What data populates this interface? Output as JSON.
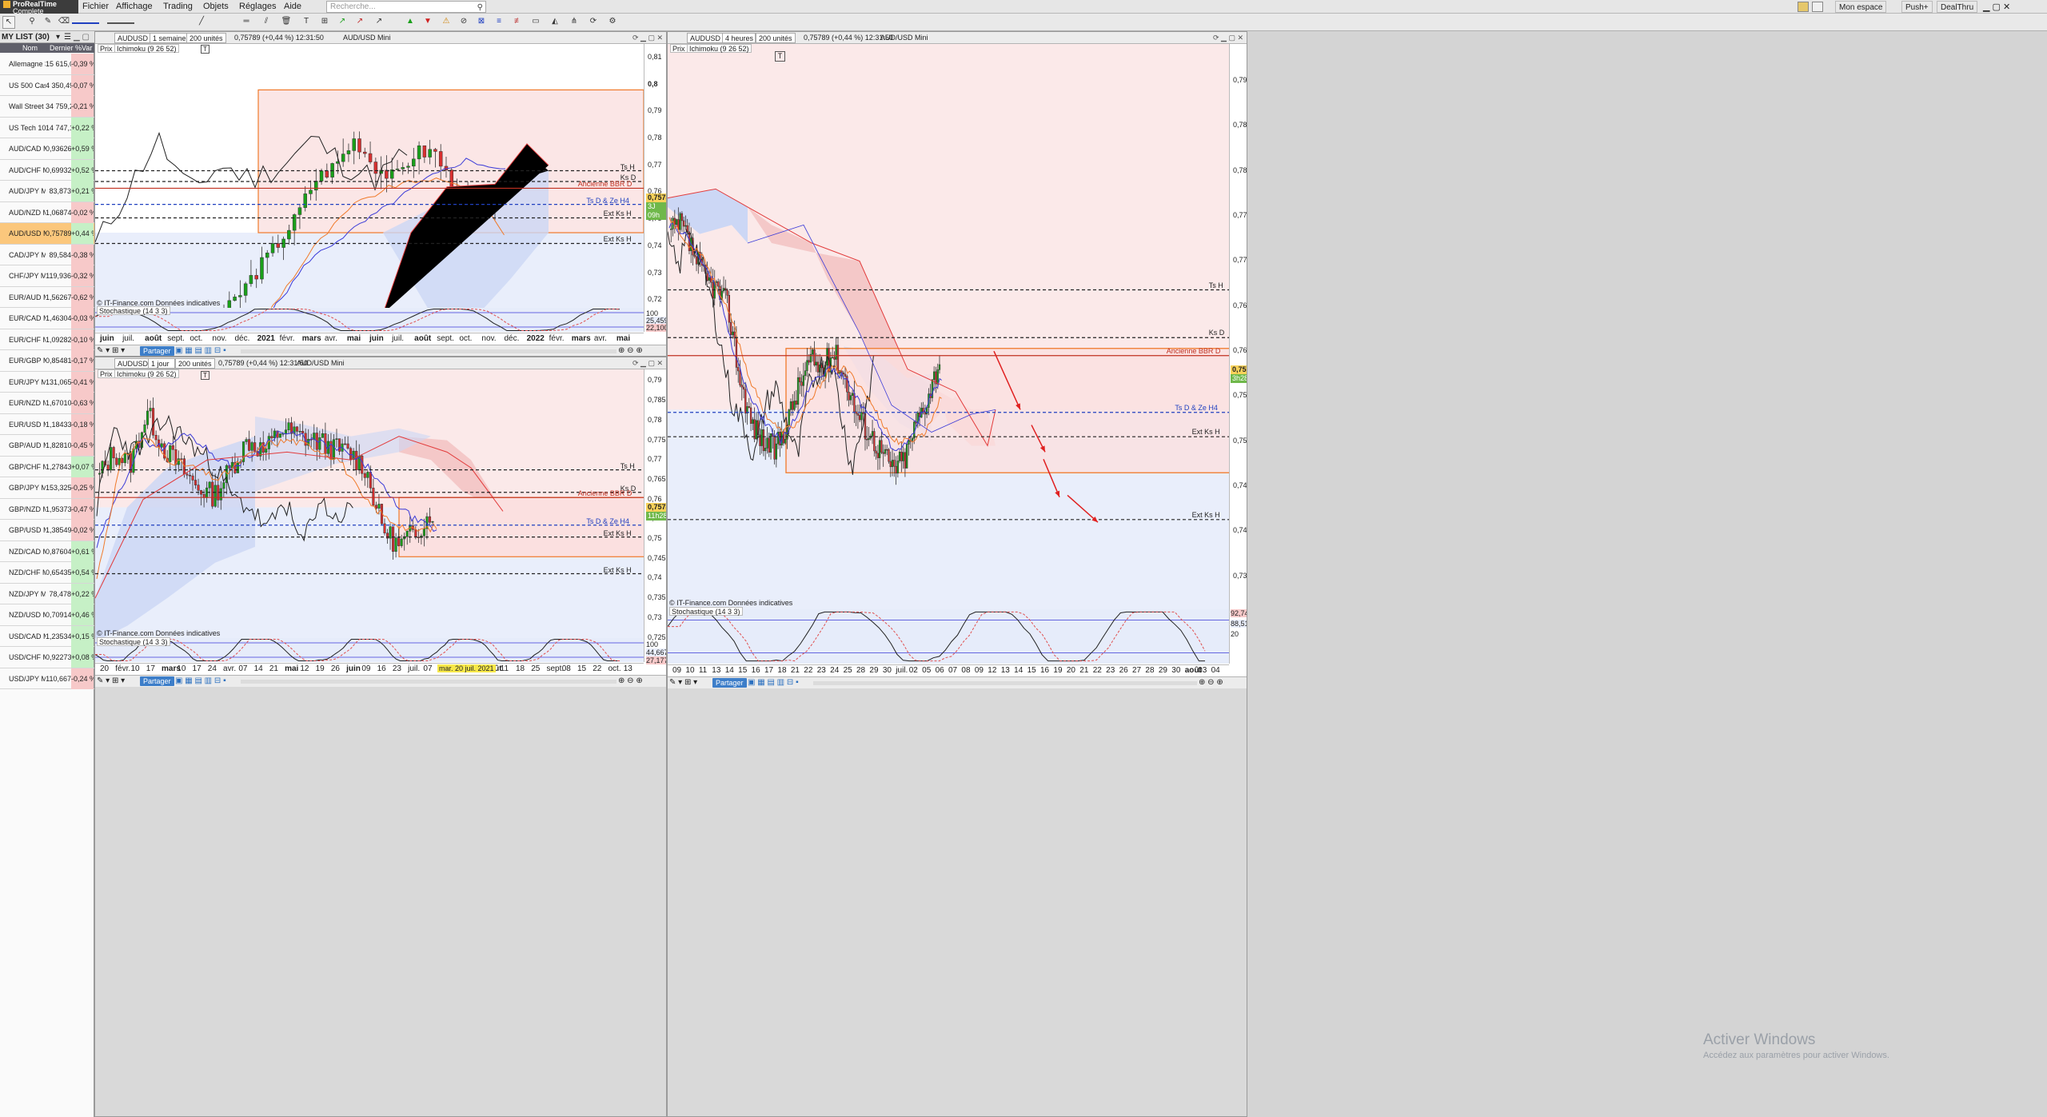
{
  "app": {
    "logo_line1": "ProRealTime",
    "logo_line2": "Complete"
  },
  "menu": [
    "Fichier",
    "Affichage",
    "Trading",
    "Objets",
    "Réglages",
    "Aide"
  ],
  "search": {
    "placeholder": "Recherche..."
  },
  "top_right": {
    "space": "Mon espace",
    "push": "Push+",
    "dealthru": "DealThru"
  },
  "watchlist": {
    "title": "MY LIST (30)",
    "columns": {
      "name": "Nom",
      "last": "Dernier",
      "var": "%Var"
    },
    "rows": [
      {
        "name": "Allemagne 30 ...",
        "last": "15 615,0",
        "var": "-0,39 %"
      },
      {
        "name": "US 500 Cash ...",
        "last": "4 350,49",
        "var": "-0,07 %"
      },
      {
        "name": "Wall Street Ca...",
        "last": "34 759,2",
        "var": "-0,21 %"
      },
      {
        "name": "US Tech 100 ...",
        "last": "14 747,1",
        "var": "+0,22 %"
      },
      {
        "name": "AUD/CAD Mini",
        "last": "0,93626",
        "var": "+0,59 %"
      },
      {
        "name": "AUD/CHF Mini",
        "last": "0,69932",
        "var": "+0,52 %"
      },
      {
        "name": "AUD/JPY Mini",
        "last": "83,873",
        "var": "+0,21 %"
      },
      {
        "name": "AUD/NZD Mini",
        "last": "1,06874",
        "var": "-0,02 %"
      },
      {
        "name": "AUD/USD Mini",
        "last": "0,75789",
        "var": "+0,44 %"
      },
      {
        "name": "CAD/JPY Mini",
        "last": "89,584",
        "var": "-0,38 %"
      },
      {
        "name": "CHF/JPY Mini",
        "last": "119,936",
        "var": "-0,32 %"
      },
      {
        "name": "EUR/AUD Mini",
        "last": "1,56267",
        "var": "-0,62 %"
      },
      {
        "name": "EUR/CAD Mini",
        "last": "1,46304",
        "var": "-0,03 %"
      },
      {
        "name": "EUR/CHF Mini",
        "last": "1,09282",
        "var": "-0,10 %"
      },
      {
        "name": "EUR/GBP Mini",
        "last": "0,85481",
        "var": "-0,17 %"
      },
      {
        "name": "EUR/JPY Mini",
        "last": "131,065",
        "var": "-0,41 %"
      },
      {
        "name": "EUR/NZD Mini",
        "last": "1,67010",
        "var": "-0,63 %"
      },
      {
        "name": "EUR/USD Mini",
        "last": "1,18433",
        "var": "-0,18 %"
      },
      {
        "name": "GBP/AUD Mini",
        "last": "1,82810",
        "var": "-0,45 %"
      },
      {
        "name": "GBP/CHF Mini",
        "last": "1,27843",
        "var": "+0,07 %"
      },
      {
        "name": "GBP/JPY Mini",
        "last": "153,325",
        "var": "-0,25 %"
      },
      {
        "name": "GBP/NZD Mini",
        "last": "1,95373",
        "var": "-0,47 %"
      },
      {
        "name": "GBP/USD Mini",
        "last": "1,38549",
        "var": "-0,02 %"
      },
      {
        "name": "NZD/CAD Mini",
        "last": "0,87604",
        "var": "+0,61 %"
      },
      {
        "name": "NZD/CHF Mini",
        "last": "0,65435",
        "var": "+0,54 %"
      },
      {
        "name": "NZD/JPY Mini",
        "last": "78,478",
        "var": "+0,22 %"
      },
      {
        "name": "NZD/USD Mini",
        "last": "0,70914",
        "var": "+0,46 %"
      },
      {
        "name": "USD/CAD Mini",
        "last": "1,23534",
        "var": "+0,15 %"
      },
      {
        "name": "USD/CHF Mini",
        "last": "0,92273",
        "var": "+0,08 %"
      },
      {
        "name": "USD/JPY Mini",
        "last": "110,667",
        "var": "-0,24 %"
      }
    ]
  },
  "common": {
    "symbol": "AUDUSD",
    "units": "200 unités",
    "quote": "0,75789 (+0,44 %) 12:31:50",
    "instrument": "AUD/USD Mini",
    "price_tab": "Prix",
    "ichimoku": "Ichimoku (9 26 52)",
    "stochastic": "Stochastique (14 3 3)",
    "credit": "© IT-Finance.com Données indicatives",
    "share": "Partager",
    "price_tag": "0,75789"
  },
  "colors": {
    "cloud_bull": "#ccd7f5",
    "cloud_bear": "#f8d2d2",
    "kijun": "#e23b3b",
    "tenkun": "#3a3ad8",
    "chikou": "#222222",
    "orange": "#f07a2a",
    "up": "#1aa01a",
    "down": "#d83030"
  },
  "panels": {
    "weekly": {
      "period": "1 semaine",
      "time_tag": "3J 09h",
      "yticks": [
        "0,81",
        "0,8",
        "0,79",
        "0,78",
        "0,77",
        "0,76",
        "0,75",
        "0,74",
        "0,73",
        "0,72"
      ],
      "stoch_ticks": [
        "100",
        "25,459",
        "22,100"
      ],
      "xticks": [
        "juin",
        "juil.",
        "août",
        "sept.",
        "oct.",
        "nov.",
        "déc.",
        "2021",
        "févr.",
        "mars",
        "avr.",
        "mai",
        "juin",
        "juil.",
        "août",
        "sept.",
        "oct.",
        "nov.",
        "déc.",
        "2022",
        "févr.",
        "mars",
        "avr.",
        "mai"
      ]
    },
    "daily": {
      "period": "1 jour",
      "time_tag": "11h28m",
      "yticks": [
        "0,79",
        "0,785",
        "0,78",
        "0,775",
        "0,77",
        "0,765",
        "0,76",
        "0,755",
        "0,75",
        "0,745",
        "0,74",
        "0,735",
        "0,73",
        "0,725"
      ],
      "stoch_ticks": [
        "100",
        "44,667",
        "27,177"
      ],
      "cursor_date": "mar. 20 juil. 2021",
      "xticks": [
        "20",
        "févr.",
        "10",
        "17",
        "mars",
        "10",
        "17",
        "24",
        "avr.",
        "07",
        "14",
        "21",
        "mai",
        "12",
        "19",
        "26",
        "juin",
        "09",
        "16",
        "23",
        "juil.",
        "07",
        "14",
        "21",
        "28",
        "août",
        "11",
        "18",
        "25",
        "sept.",
        "08",
        "15",
        "22",
        "oct.",
        "13"
      ]
    },
    "h4": {
      "period": "4 heures",
      "time_tag": "3h28m",
      "yticks": [
        "0,79",
        "0,785",
        "0,78",
        "0,775",
        "0,77",
        "0,765",
        "0,76",
        "0,755",
        "0,75",
        "0,745",
        "0,74",
        "0,735"
      ],
      "stoch_ticks": [
        "92,745",
        "88,514",
        "20"
      ],
      "xticks": [
        "09",
        "10",
        "11",
        "13",
        "14",
        "15",
        "16",
        "17",
        "18",
        "21",
        "22",
        "23",
        "24",
        "25",
        "28",
        "29",
        "30",
        "juil.",
        "02",
        "05",
        "06",
        "07",
        "08",
        "09",
        "12",
        "13",
        "14",
        "15",
        "16",
        "19",
        "20",
        "21",
        "22",
        "23",
        "26",
        "27",
        "28",
        "29",
        "30",
        "août",
        "03",
        "04"
      ]
    }
  },
  "levels": {
    "ts_h": "Ts H",
    "ks_d": "Ks D",
    "bbr_d": "Ancienne BBR D",
    "tsd_ze": "Ts D & Ze H4",
    "ext_ks": "Ext Ks H"
  },
  "watermark": {
    "line1": "Activer Windows",
    "line2": "Accédez aux paramètres pour activer Windows."
  }
}
